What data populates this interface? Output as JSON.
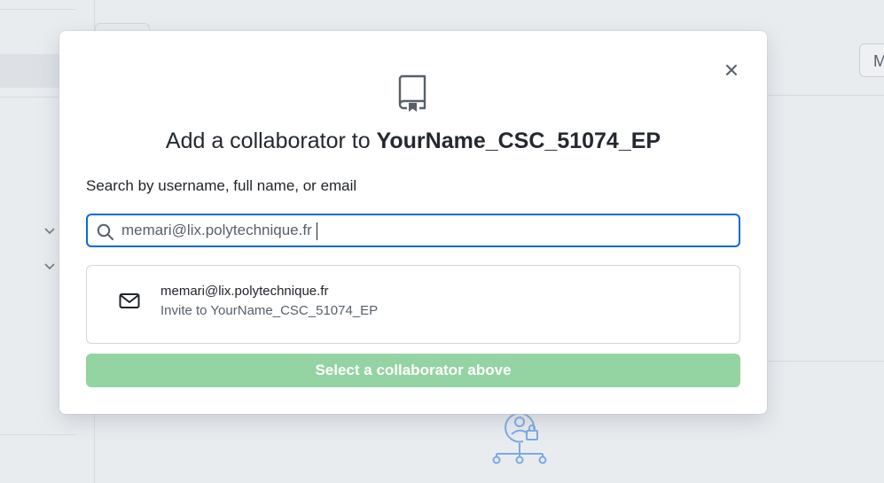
{
  "background": {
    "partial_button_label": "M"
  },
  "modal": {
    "title_prefix": "Add a collaborator to ",
    "repo_name": "YourName_CSC_51074_EP",
    "search_label": "Search by username, full name, or email",
    "search_value": "memari@lix.polytechnique.fr",
    "result": {
      "email": "memari@lix.polytechnique.fr",
      "invite_text": "Invite to YourName_CSC_51074_EP"
    },
    "submit_label": "Select a collaborator above"
  },
  "icons": {
    "close": "close-icon",
    "repo": "repo-icon",
    "search": "search-icon",
    "mail": "mail-icon"
  },
  "colors": {
    "focus_border": "#0969da",
    "disabled_button": "#94d3a2",
    "illustration": "#7aa9e6"
  }
}
